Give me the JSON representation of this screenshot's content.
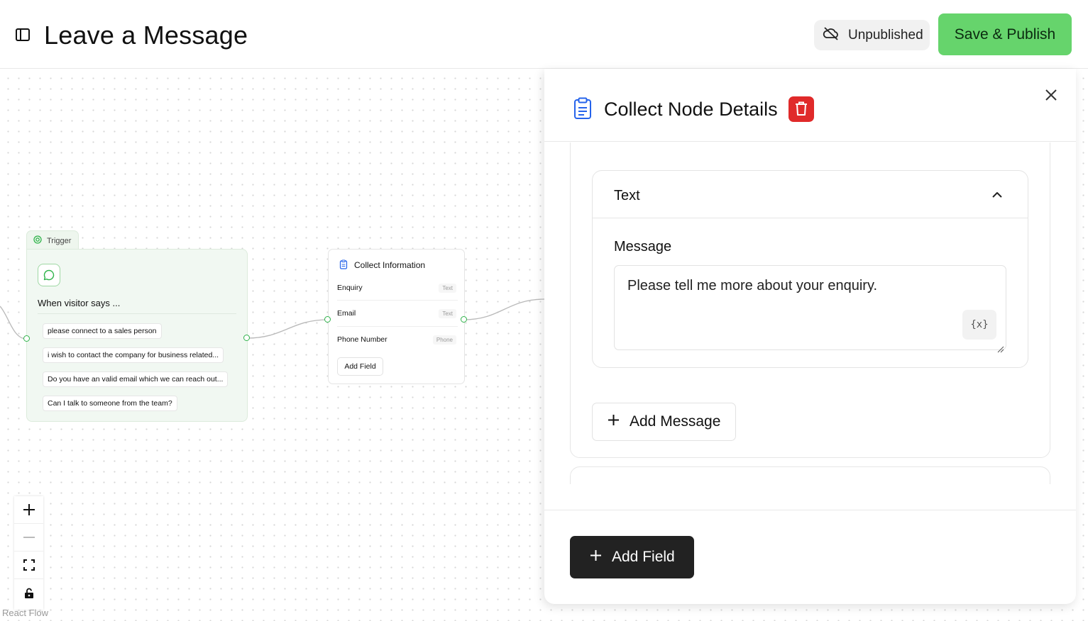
{
  "header": {
    "title": "Leave a Message",
    "status_label": "Unpublished",
    "publish_label": "Save & Publish"
  },
  "trigger_node": {
    "tab_label": "Trigger",
    "heading": "When visitor says ...",
    "phrases": [
      "please connect to a sales person",
      "i wish to contact the company for business related...",
      "Do you have an valid email which we can reach out...",
      "Can I talk to someone from the team?"
    ]
  },
  "collect_node": {
    "title": "Collect Information",
    "fields": [
      {
        "label": "Enquiry",
        "type": "Text"
      },
      {
        "label": "Email",
        "type": "Text"
      },
      {
        "label": "Phone Number",
        "type": "Phone"
      }
    ],
    "add_field_label": "Add Field"
  },
  "canvas": {
    "attribution": "React Flow"
  },
  "panel": {
    "title": "Collect Node Details",
    "section_label": "Text",
    "message_label": "Message",
    "message_value": "Please tell me more about your enquiry.",
    "variable_button": "{x}",
    "add_message_label": "Add Message",
    "add_field_label": "Add Field"
  },
  "colors": {
    "publish": "#66d46c",
    "delete": "#e02a2a",
    "accent_blue": "#2563eb",
    "handle_green": "#2fb34a"
  }
}
